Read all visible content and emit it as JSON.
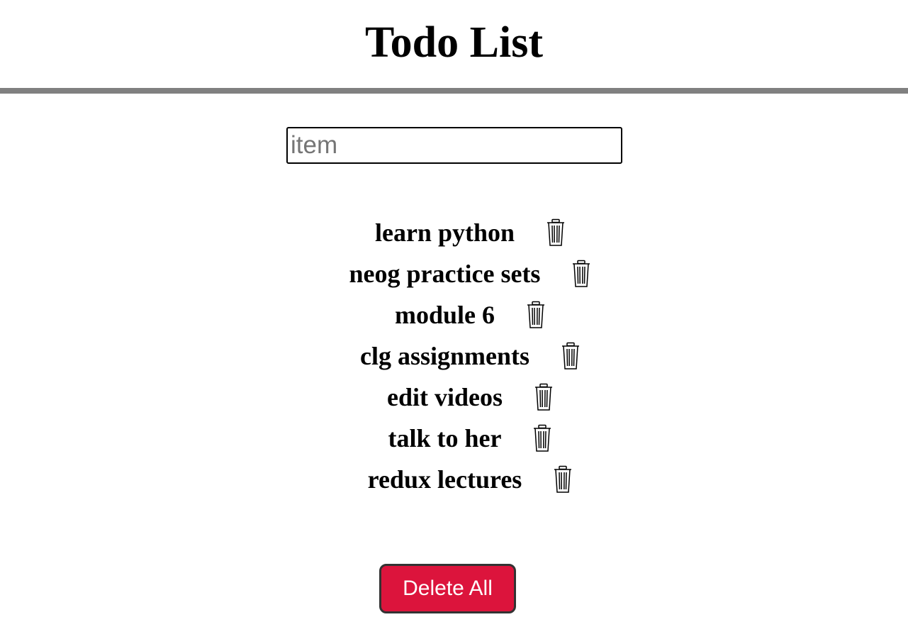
{
  "header": {
    "title": "Todo List"
  },
  "input": {
    "placeholder": "item",
    "value": ""
  },
  "todos": [
    {
      "label": "learn python",
      "icon": "trash-icon"
    },
    {
      "label": "neog practice sets",
      "icon": "trash-icon"
    },
    {
      "label": "module 6",
      "icon": "trash-icon"
    },
    {
      "label": "clg assignments",
      "icon": "trash-icon"
    },
    {
      "label": "edit videos",
      "icon": "trash-icon"
    },
    {
      "label": "talk to her",
      "icon": "trash-icon"
    },
    {
      "label": "redux lectures",
      "icon": "trash-icon"
    }
  ],
  "actions": {
    "delete_all_label": "Delete All"
  },
  "colors": {
    "divider": "#808080",
    "delete_all_bg": "#dc143c",
    "delete_all_text": "#ffffff"
  }
}
